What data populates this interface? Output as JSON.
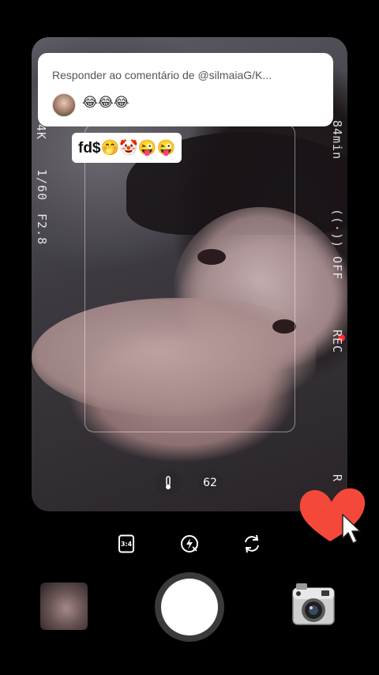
{
  "viewfinder": {
    "left_info": [
      "4K",
      "1/60",
      "F2.8"
    ],
    "right_info": [
      "84min",
      "((·)) OFF",
      "REC",
      "R"
    ],
    "temperature_icon": "thermometer-icon",
    "value_chip": "62"
  },
  "reply_banner": {
    "title": "Responder ao comentário de @silmaiaG/K...",
    "comment_emojis": "😂😂😂"
  },
  "sticker": {
    "text": "fd$🤭🤡😜😜"
  },
  "controls": {
    "ratio_label": "3:4",
    "flash_icon": "flash-auto-icon",
    "flip_icon": "flip-camera-icon"
  },
  "colors": {
    "heart": "#f4483a",
    "rec": "#ff2a2a",
    "background": "#000000"
  }
}
